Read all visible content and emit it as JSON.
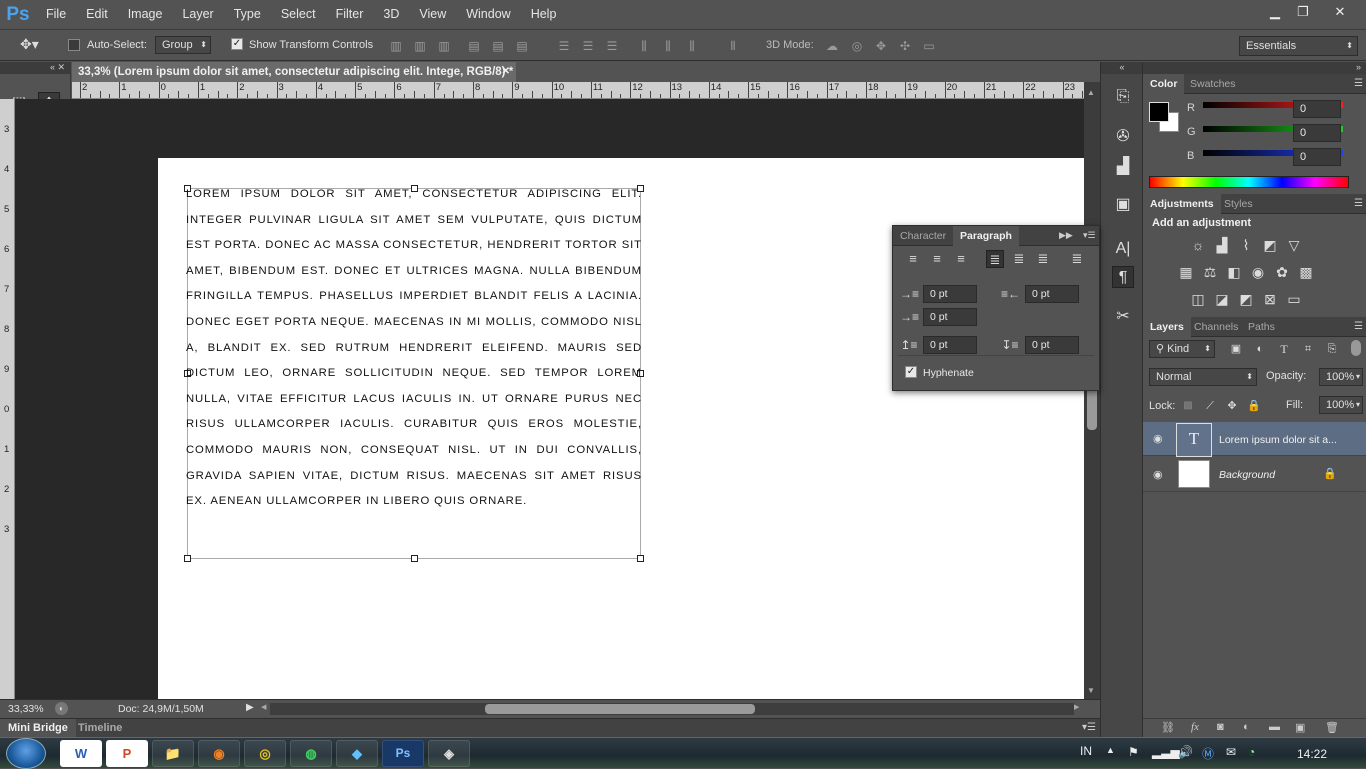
{
  "app": {
    "logo": "Ps"
  },
  "menu": [
    "File",
    "Edit",
    "Image",
    "Layer",
    "Type",
    "Select",
    "Filter",
    "3D",
    "View",
    "Window",
    "Help"
  ],
  "window_controls": {
    "minimize": "▁",
    "restore": "❐",
    "close": "✕"
  },
  "options": {
    "auto_select_label": "Auto-Select:",
    "auto_select_checked": false,
    "group_value": "Group",
    "show_transform_label": "Show Transform Controls",
    "show_transform_checked": true,
    "mode_3d_label": "3D Mode:",
    "workspace": "Essentials"
  },
  "document": {
    "tab_title": "33,3% (Lorem ipsum dolor sit amet, consectetur adipiscing elit. Intege, RGB/8) *",
    "text": "Lorem ipsum dolor sit amet, consectetur adipiscing elit. Integer pulvinar ligula sit amet sem vulputate, quis dictum est porta. Donec ac massa consectetur, hendrerit tortor sit amet, bibendum est. Donec et ultrices magna. Nulla bibendum fringilla tempus. Phasellus imperdiet blandit felis a lacinia. Donec eget porta neque. Maecenas in mi mollis, commodo nisl a, blandit ex. Sed rutrum hendrerit eleifend. Mauris sed dictum leo, ornare sollicitudin neque. Sed tempor lorem nulla, vitae efficitur lacus iaculis in. Ut ornare purus nec risus ullamcorper iaculis. Curabitur quis eros molestie, commodo mauris non, consequat nisl. Ut in dui convallis, gravida sapien vitae, dictum risus. Maecenas sit amet risus ex. Aenean ullamcorper in libero quis ornare."
  },
  "ruler_top": [
    "2",
    "1",
    "0",
    "1",
    "2",
    "3",
    "4",
    "5",
    "6",
    "7",
    "8",
    "9",
    "10",
    "11",
    "12",
    "13",
    "14",
    "15",
    "16",
    "17",
    "18",
    "19",
    "20",
    "21",
    "22",
    "23"
  ],
  "ruler_left": [
    "3",
    "4",
    "5",
    "6",
    "7",
    "8",
    "9",
    "0",
    "1",
    "2",
    "3"
  ],
  "status": {
    "zoom": "33,33%",
    "doc": "Doc: 24,9M/1,50M"
  },
  "bottom_tabs": [
    "Mini Bridge",
    "Timeline"
  ],
  "color_panel": {
    "tabs": [
      "Color",
      "Swatches"
    ],
    "channels": [
      {
        "label": "R",
        "value": "0",
        "color": "#ff2020"
      },
      {
        "label": "G",
        "value": "0",
        "color": "#20d020"
      },
      {
        "label": "B",
        "value": "0",
        "color": "#2040ff"
      }
    ]
  },
  "adjustments_panel": {
    "tabs": [
      "Adjustments",
      "Styles"
    ],
    "heading": "Add an adjustment"
  },
  "layers_panel": {
    "tabs": [
      "Layers",
      "Channels",
      "Paths"
    ],
    "kind_label": "Kind",
    "blend_mode": "Normal",
    "opacity_label": "Opacity:",
    "opacity_value": "100%",
    "lock_label": "Lock:",
    "fill_label": "Fill:",
    "fill_value": "100%",
    "layers": [
      {
        "name": "Lorem ipsum dolor sit a...",
        "type": "text",
        "selected": true
      },
      {
        "name": "Background",
        "type": "background",
        "selected": false
      }
    ]
  },
  "paragraph_panel": {
    "tabs": [
      "Character",
      "Paragraph"
    ],
    "fields": [
      "0 pt",
      "0 pt",
      "0 pt",
      "0 pt",
      "0 pt"
    ],
    "hyphenate_label": "Hyphenate",
    "hyphenate_checked": true
  },
  "taskbar": {
    "apps": [
      "W",
      "P",
      "📁",
      "◉",
      "◎",
      "◍",
      "◆",
      "Ps",
      "◈"
    ],
    "lang": "IN",
    "time": "14:22"
  }
}
